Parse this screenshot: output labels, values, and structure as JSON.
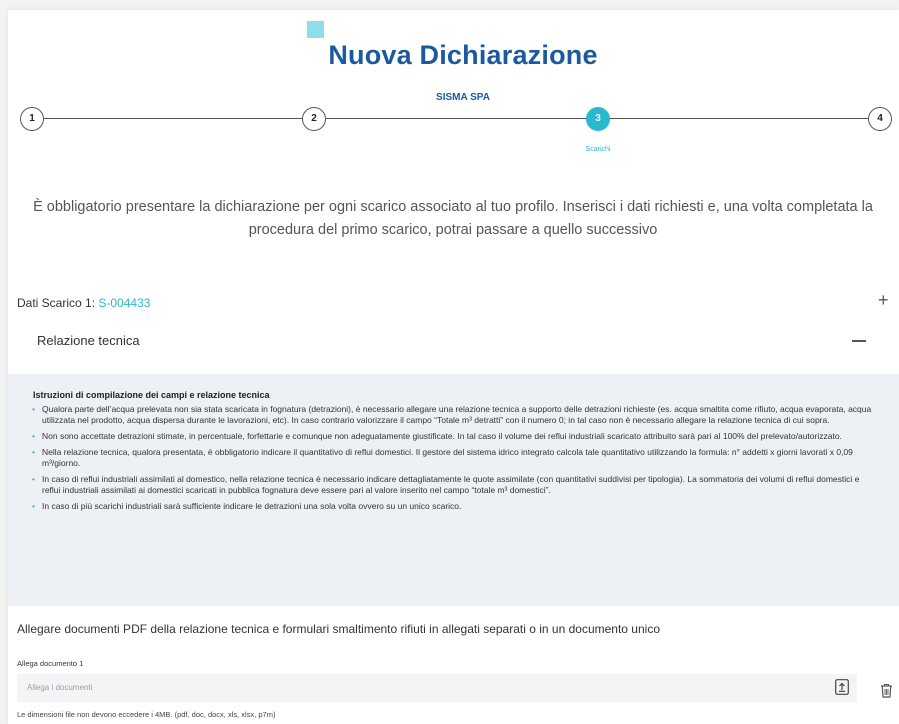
{
  "header": {
    "title": "Nuova Dichiarazione",
    "company": "SISMA SPA"
  },
  "stepper": {
    "steps": [
      {
        "number": "1"
      },
      {
        "number": "2"
      },
      {
        "number": "3",
        "label": "Scarichi",
        "active": true
      },
      {
        "number": "4"
      }
    ]
  },
  "intro": "È obbligatorio presentare la dichiarazione per ogni scarico associato al tuo profilo. Inserisci i dati richiesti e, una volta completata la procedura del primo scarico, potrai passare a quello successivo",
  "scarico": {
    "label": "Dati Scarico 1:",
    "code": "S-004433",
    "expand_icon": "plus-icon"
  },
  "relazione": {
    "title": "Relazione tecnica",
    "collapse_icon": "minus-icon",
    "instructions_title": "Istruzioni di compilazione dei campi e relazione tecnica",
    "instructions": [
      "Qualora parte dell’acqua prelevata non sia stata scaricata in fognatura (detrazioni), è necessario allegare una relazione tecnica a supporto delle detrazioni richieste (es. acqua smaltita come rifiuto, acqua evaporata, acqua utilizzata nel prodotto, acqua dispersa durante le lavorazioni, etc). In caso contrario valorizzare il campo “Totale m³ detratti” con il numero 0; in tal caso non è necessario allegare la relazione tecnica di cui sopra.",
      "Non sono accettate detrazioni stimate, in percentuale, forfettarie e comunque non adeguatamente giustificate. In tal caso il volume dei reflui industriali scaricato attribuito sarà pari al 100% del prelevato/autorizzato.",
      "Nella relazione tecnica, qualora presentata, è obbligatorio indicare il quantitativo di reflui domestici. Il gestore del sistema idrico integrato calcola tale quantitativo utilizzando la formula: n° addetti x giorni lavorati x 0,09 m³/giorno.",
      "In caso di reflui industriali assimilati al domestico, nella relazione tecnica è necessario indicare dettagliatamente le quote assimilate (con quantitativi suddivisi per tipologia). La sommatoria dei volumi di reflui domestici e reflui industriali assimilati ai domestici scaricati in pubblica fognatura deve essere pari al valore inserito nel campo “totale m³ domestici”.",
      "In caso di più scarichi industriali sarà sufficiente indicare le detrazioni una sola volta ovvero su un unico scarico."
    ]
  },
  "attachments": {
    "note": "Allegare documenti PDF della relazione tecnica e formulari smaltimento rifiuti in allegati separati o in un documento unico",
    "doc_label": "Allega documento 1",
    "placeholder": "Allega i documenti",
    "hint": "Le dimensioni file non devono eccedere i 4MB. (pdf, doc, docx, xls, xlsx, p7m)"
  },
  "colors": {
    "brand_blue": "#1c5aa0",
    "accent_cyan": "#29b9cf",
    "panel_bg": "#edf0f5"
  }
}
